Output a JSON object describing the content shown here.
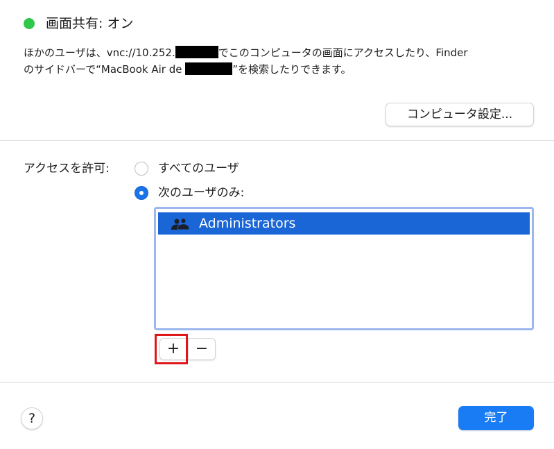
{
  "status": {
    "title": "画面共有: オン",
    "indicator_color": "#30c84b"
  },
  "description": {
    "line1_prefix": "ほかのユーザは、vnc://10.252.",
    "line1_suffix": "でこのコンピュータの画面にアクセスしたり、Finder",
    "line2_prefix": "のサイドバーで“MacBook Air de ",
    "line2_suffix": "”を検索したりできます。"
  },
  "computer_settings_button": "コンピュータ設定...",
  "access": {
    "label": "アクセスを許可:",
    "options": [
      {
        "label": "すべてのユーザ",
        "selected": false
      },
      {
        "label": "次のユーザのみ:",
        "selected": true
      }
    ]
  },
  "user_list": {
    "items": [
      {
        "label": "Administrators",
        "icon": "users-group-icon",
        "selected": true
      }
    ],
    "selection_color": "#1a66d6"
  },
  "list_controls": {
    "add": "+",
    "remove": "−"
  },
  "footer": {
    "help": "?",
    "done": "完了",
    "done_color": "#1a7cf5"
  },
  "annotation": {
    "highlight_color": "#e0161b"
  }
}
